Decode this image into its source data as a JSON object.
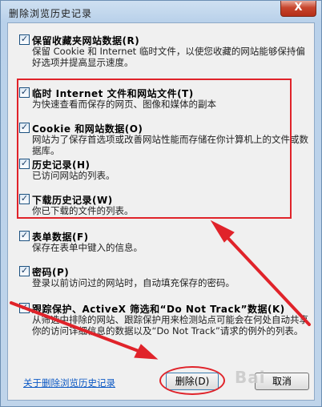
{
  "window": {
    "title": "删除浏览历史记录",
    "close_glyph": "X"
  },
  "options": [
    {
      "title": "保留收藏夹网站数据(R)",
      "desc": "保留 Cookie 和 Internet 临时文件，以使您收藏的网站能够保持偏好选项并提高显示速度。",
      "checked": true
    },
    {
      "title": "临时 Internet 文件和网站文件(T)",
      "desc": "为快速查看而保存的网页、图像和媒体的副本",
      "checked": true
    },
    {
      "title": "Cookie 和网站数据(O)",
      "desc": "网站为了保存首选项或改善网站性能而存储在你计算机上的文件或数据库。",
      "checked": true
    },
    {
      "title": "历史记录(H)",
      "desc": "已访问网站的列表。",
      "checked": true
    },
    {
      "title": "下载历史记录(W)",
      "desc": "你已下载的文件的列表。",
      "checked": true
    },
    {
      "title": "表单数据(F)",
      "desc": "保存在表单中键入的信息。",
      "checked": true
    },
    {
      "title": "密码(P)",
      "desc": "登录以前访问过的网站时，自动填充保存的密码。",
      "checked": true
    },
    {
      "title": "跟踪保护、ActiveX 筛选和“Do Not Track”数据(K)",
      "desc": "从筛选中排除的网站、跟踪保护用来检测站点可能会在何处自动共享你的访问详细信息的数据以及“Do Not Track”请求的例外的列表。",
      "checked": true
    }
  ],
  "footer": {
    "link": "关于删除浏览历史记录",
    "delete_label": "删除(D)",
    "cancel_label": "取消",
    "watermark": "Bai"
  },
  "check_glyph": "✓",
  "accent_colors": {
    "highlight": "#e0232a",
    "link": "#0b58c4"
  }
}
